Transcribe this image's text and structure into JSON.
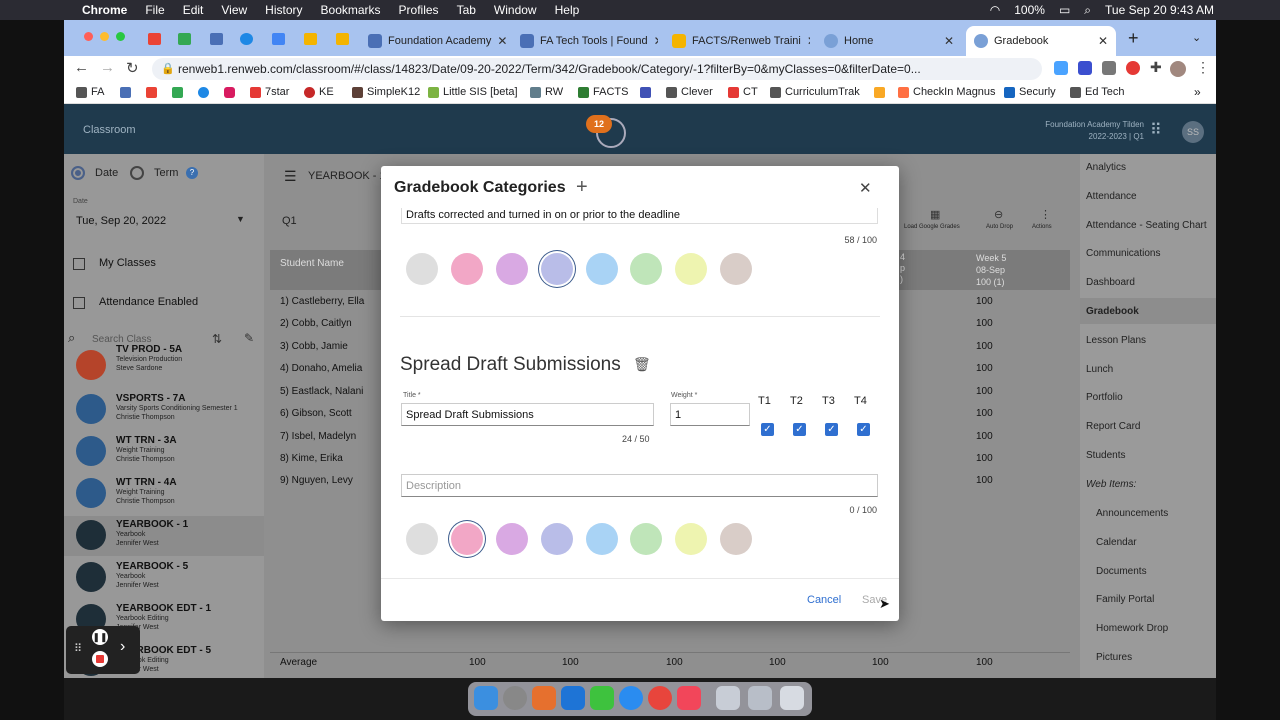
{
  "mac_menu": {
    "app": "Chrome",
    "items": [
      "File",
      "Edit",
      "View",
      "History",
      "Bookmarks",
      "Profiles",
      "Tab",
      "Window",
      "Help"
    ],
    "battery": "100%",
    "clock": "Tue Sep 20  9:43 AM"
  },
  "tabs": [
    {
      "label": "Foundation Academy",
      "color": "#4a6fb5"
    },
    {
      "label": "FA Tech Tools | Found",
      "color": "#4a6fb5"
    },
    {
      "label": "FACTS/Renweb Traini",
      "color": "#f4b400"
    },
    {
      "label": "Home",
      "color": "#7aa0d6"
    },
    {
      "label": "Gradebook",
      "color": "#7aa0d6"
    }
  ],
  "url": "renweb1.renweb.com/classroom/#/class/14823/Date/09-20-2022/Term/342/Gradebook/Category/-1?filterBy=0&myClasses=0&filterDate=0...",
  "bookmarks": [
    "FA",
    "7star",
    "KE",
    "SimpleK12",
    "Little SIS [beta]",
    "RW",
    "FACTS",
    "Clever",
    "CT",
    "CurriculumTrak",
    "CheckIn Magnus",
    "Securly",
    "Ed Tech"
  ],
  "app": {
    "title": "Classroom",
    "notif_count": "12",
    "school": "Foundation Academy Tilden",
    "term": "2022-2023 | Q1",
    "avatar": "SS"
  },
  "left": {
    "date_label": "Date",
    "term_label": "Term",
    "help": "?",
    "date_field_label": "Date",
    "date_value": "Tue, Sep 20, 2022",
    "my_classes": "My Classes",
    "attendance_enabled": "Attendance Enabled",
    "search_placeholder": "Search Class",
    "classes": [
      {
        "title": "TV PROD - 5A",
        "sub1": "Television Production",
        "sub2": "Steve Sardone",
        "color": "#b5442a"
      },
      {
        "title": "VSPORTS - 7A",
        "sub1": "Varsity Sports Conditioning Semester 1",
        "sub2": "Christie Thompson",
        "color": "#2d5a8a"
      },
      {
        "title": "WT TRN - 3A",
        "sub1": "Weight Training",
        "sub2": "Christie Thompson",
        "color": "#2d5a8a"
      },
      {
        "title": "WT TRN - 4A",
        "sub1": "Weight Training",
        "sub2": "Christie Thompson",
        "color": "#2d5a8a"
      },
      {
        "title": "YEARBOOK - 1",
        "sub1": "Yearbook",
        "sub2": "Jennifer West",
        "color": "#1e2e38"
      },
      {
        "title": "YEARBOOK - 5",
        "sub1": "Yearbook",
        "sub2": "Jennifer West",
        "color": "#1e2e38"
      },
      {
        "title": "YEARBOOK EDT - 1",
        "sub1": "Yearbook Editing",
        "sub2": "Jennifer West",
        "color": "#1e2e38"
      },
      {
        "title": "YEARBOOK EDT - 5",
        "sub1": "Yearbook Editing",
        "sub2": "Jennifer West",
        "color": "#1e2e38"
      }
    ]
  },
  "main": {
    "class_title": "YEARBOOK - 1",
    "term_select": "Q1",
    "toolbar": {
      "load_google": "Load Google Grades",
      "auto_drop": "Auto Drop",
      "actions": "Actions"
    },
    "col_student": "Student Name",
    "week_col": {
      "l1": "Week 5",
      "l2": "08-Sep",
      "l3": "100 (1)"
    },
    "partial_col": {
      "l1": "4",
      "l2": "p",
      "l3": ")"
    },
    "students": [
      "1) Castleberry, Ella",
      "2) Cobb, Caitlyn",
      "3) Cobb, Jamie",
      "4) Donaho, Amelia",
      "5) Eastlack, Nalani",
      "6) Gibson, Scott",
      "7) Isbel, Madelyn",
      "8) Kime, Erika",
      "9) Nguyen, Levy"
    ],
    "grade": "100",
    "average_label": "Average",
    "averages": [
      "100",
      "100",
      "100",
      "100",
      "100",
      "100"
    ]
  },
  "right_nav": [
    "Analytics",
    "Attendance",
    "Attendance - Seating Chart",
    "Communications",
    "Dashboard",
    "Gradebook",
    "Lesson Plans",
    "Lunch",
    "Portfolio",
    "Report Card",
    "Students"
  ],
  "web_items_label": "Web Items:",
  "web_items": [
    "Announcements",
    "Calendar",
    "Documents",
    "Family Portal",
    "Homework Drop",
    "Pictures"
  ],
  "modal": {
    "title": "Gradebook Categories",
    "add": "+",
    "close": "✕",
    "top_description": "Drafts corrected and turned in on or prior to the deadline",
    "top_counter": "58 / 100",
    "section_title": "Spread Draft Submissions",
    "title_label": "Title *",
    "title_value": "Spread Draft Submissions",
    "title_counter": "24 / 50",
    "weight_label": "Weight *",
    "weight_value": "1",
    "terms": [
      "T1",
      "T2",
      "T3",
      "T4"
    ],
    "description_placeholder": "Description",
    "desc_counter": "0 / 100",
    "cancel": "Cancel",
    "save": "Save",
    "swatches": [
      "#dedede",
      "#f2a7c6",
      "#d9a9e3",
      "#b9bde8",
      "#a9d3f5",
      "#bfe5b9",
      "#eef4b0",
      "#d9cdc8"
    ]
  }
}
